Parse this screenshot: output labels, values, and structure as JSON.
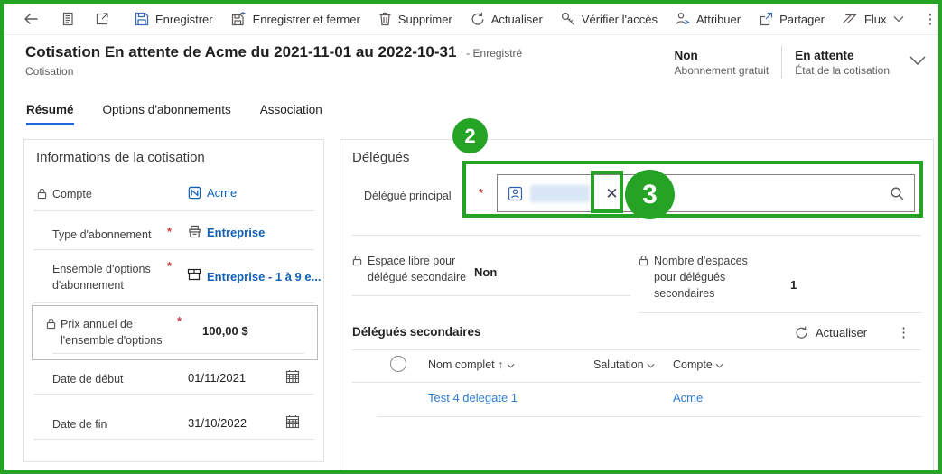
{
  "colors": {
    "annotation": "#24a325",
    "link": "#1160b7",
    "link_light": "#2b7cd3",
    "tab_accent": "#2266e3",
    "required": "#cd4040"
  },
  "toolbar": {
    "save": "Enregistrer",
    "save_close": "Enregistrer et fermer",
    "delete": "Supprimer",
    "refresh": "Actualiser",
    "check_access": "Vérifier l'accès",
    "assign": "Attribuer",
    "share": "Partager",
    "flow": "Flux",
    "more": "⋮"
  },
  "header": {
    "title": "Cotisation En attente de Acme du 2021-11-01 au 2022-10-31",
    "saved_suffix": "- Enregistré",
    "entity": "Cotisation",
    "stats": [
      {
        "value": "Non",
        "caption": "Abonnement gratuit"
      },
      {
        "value": "En attente",
        "caption": "État de la cotisation"
      }
    ]
  },
  "tabs": {
    "resume": "Résumé",
    "options": "Options d'abonnements",
    "association": "Association"
  },
  "left_card": {
    "title": "Informations de la cotisation",
    "compte": {
      "label": "Compte",
      "value": "Acme"
    },
    "type": {
      "label": "Type d'abonnement",
      "value": "Entreprise"
    },
    "ensemble": {
      "label": "Ensemble d'options d'abonnement",
      "value": "Entreprise - 1 à 9 e..."
    },
    "prix": {
      "label": "Prix annuel de l'ensemble d'options",
      "value": "100,00 $"
    },
    "debut": {
      "label": "Date de début",
      "value": "01/11/2021"
    },
    "fin": {
      "label": "Date de fin",
      "value": "31/10/2022"
    }
  },
  "right_card": {
    "title": "Délégués",
    "principal": {
      "label": "Délégué principal"
    },
    "espace": {
      "label": "Espace libre pour délégué secondaire",
      "value": "Non"
    },
    "nombre": {
      "label": "Nombre d'espaces pour délégués secondaires",
      "value": "1"
    },
    "subgrid": {
      "title": "Délégués secondaires",
      "refresh": "Actualiser",
      "columns": {
        "name": "Nom complet",
        "salutation": "Salutation",
        "account": "Compte"
      },
      "rows": [
        {
          "name": "Test 4 delegate 1",
          "salutation": "",
          "account": "Acme"
        }
      ]
    }
  },
  "annotations": {
    "step2": "2",
    "step3": "3"
  }
}
